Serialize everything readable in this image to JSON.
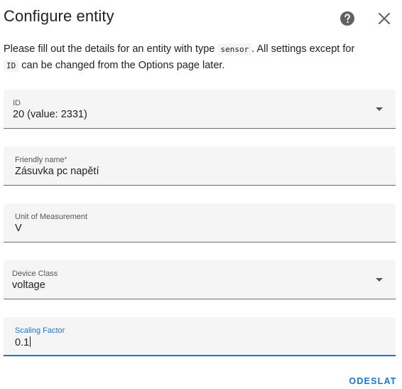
{
  "dialog": {
    "title": "Configure entity",
    "help_icon": "help-circle-icon",
    "close_icon": "close-icon",
    "description": {
      "part1": "Please fill out the details for an entity with type ",
      "type_code": "sensor",
      "part2": ". All settings except for",
      "id_code": "ID",
      "part3": " can be changed from the Options page later."
    }
  },
  "fields": {
    "id": {
      "label": "ID",
      "value": "20 (value: 2331)",
      "kind": "select"
    },
    "friendly_name": {
      "label": "Friendly name",
      "required_mark": "*",
      "value": "Zásuvka pc napětí"
    },
    "unit": {
      "label": "Unit of Measurement",
      "value": "V"
    },
    "device_class": {
      "label": "Device Class",
      "value": "voltage",
      "kind": "select"
    },
    "scaling_factor": {
      "label": "Scaling Factor",
      "value": "0.1",
      "focused": true
    }
  },
  "actions": {
    "submit_label": "ODESLAT"
  },
  "colors": {
    "accent": "#1976d2",
    "field_bg": "#f5f5f5",
    "text": "#212121"
  }
}
